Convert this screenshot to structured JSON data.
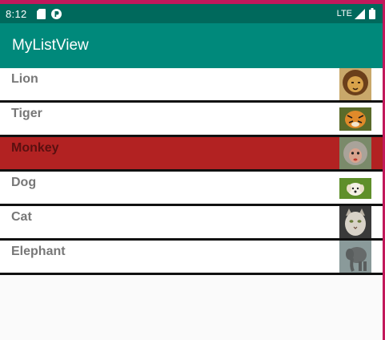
{
  "status_bar": {
    "time": "8:12",
    "network": "LTE",
    "icons": [
      "sd-card-icon",
      "p-icon",
      "signal-icon",
      "battery-icon"
    ]
  },
  "app_bar": {
    "title": "MyListView",
    "color": "#00897b"
  },
  "list": {
    "items": [
      {
        "name": "Lion",
        "image": "lion-image",
        "selected": false
      },
      {
        "name": "Tiger",
        "image": "tiger-image",
        "selected": false
      },
      {
        "name": "Monkey",
        "image": "monkey-image",
        "selected": true
      },
      {
        "name": "Dog",
        "image": "dog-image",
        "selected": false
      },
      {
        "name": "Cat",
        "image": "cat-image",
        "selected": false
      },
      {
        "name": "Elephant",
        "image": "elephant-image",
        "selected": false
      }
    ],
    "selected_color": "#b22222",
    "divider_color": "#111111"
  }
}
